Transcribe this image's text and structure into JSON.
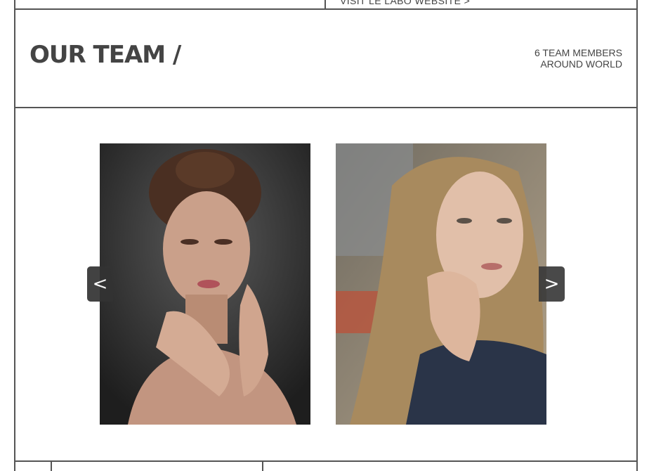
{
  "header": {
    "external_link_label": "VISIT LE LABO WEBSITE >"
  },
  "team_section": {
    "title": "OUR TEAM /",
    "info_line_1": "6 TEAM MEMBERS",
    "info_line_2": "AROUND WORLD"
  },
  "slider": {
    "prev_label": "<",
    "next_label": ">",
    "slides": [
      {
        "name": "team-member-photo-1",
        "background": "#2b2b2b"
      },
      {
        "name": "team-member-photo-2",
        "background": "#7c7a70"
      }
    ]
  },
  "colors": {
    "frame_line": "#555555",
    "text": "#444444",
    "button_bg": "#333333"
  }
}
